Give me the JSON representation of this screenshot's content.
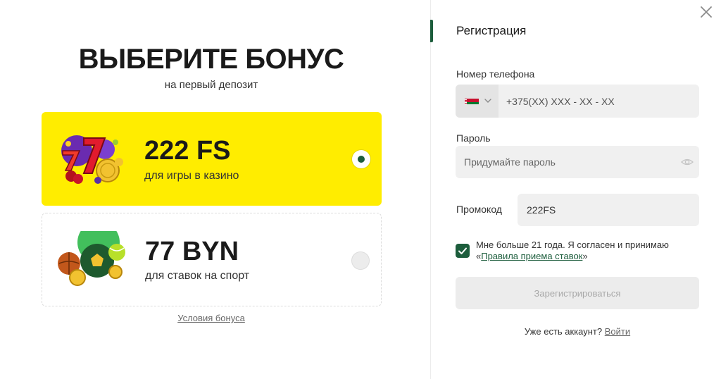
{
  "bonus": {
    "title": "ВЫБЕРИТЕ БОНУС",
    "subtitle": "на первый депозит",
    "cards": [
      {
        "amount": "222 FS",
        "description": "для игры в казино",
        "selected": true,
        "icon": "casino-slots-icon"
      },
      {
        "amount": "77 BYN",
        "description": "для ставок на спорт",
        "selected": false,
        "icon": "sports-balls-icon"
      }
    ],
    "terms_link": "Условия бонуса"
  },
  "registration": {
    "title": "Регистрация",
    "phone_label": "Номер телефона",
    "phone_placeholder": "+375(XX) XXX - XX - XX",
    "country_flag": "belarus-flag-icon",
    "password_label": "Пароль",
    "password_placeholder": "Придумайте пароль",
    "promo_label": "Промокод",
    "promo_value": "222FS",
    "agree_text": "Мне больше 21 года. Я согласен и принимаю «",
    "agree_link": "Правила приема ставок",
    "agree_end": "»",
    "agree_checked": true,
    "submit_label": "Зарегистрироваться",
    "login_prompt": "Уже есть аккаунт?",
    "login_link": "Войти"
  },
  "colors": {
    "accent": "#1c5d3c",
    "selected_card": "#ffed00",
    "field_bg": "#f0f0f0"
  }
}
